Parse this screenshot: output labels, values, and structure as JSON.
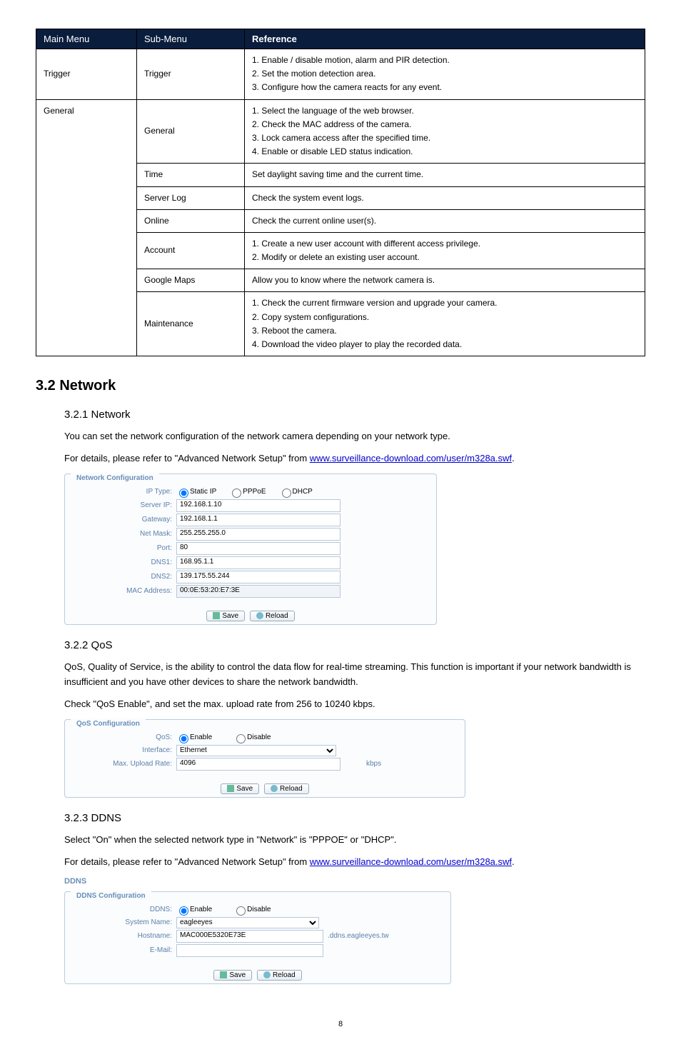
{
  "table": {
    "headers": [
      "Main Menu",
      "Sub-Menu",
      "Reference"
    ],
    "rows": [
      {
        "main": "Trigger",
        "sub": "Trigger",
        "ref": "1. Enable / disable motion, alarm and PIR detection.\n2. Set the motion detection area.\n3. Configure how the camera reacts for any event."
      },
      {
        "main": "General",
        "sub": "General",
        "ref": "1. Select the language of the web browser.\n2. Check the MAC address of the camera.\n3. Lock camera access after the specified time.\n4. Enable or disable LED status indication."
      },
      {
        "main": "",
        "sub": "Time",
        "ref": "Set daylight saving time and the current time."
      },
      {
        "main": "",
        "sub": "Server Log",
        "ref": "Check the system event logs."
      },
      {
        "main": "",
        "sub": "Online",
        "ref": "Check the current online user(s)."
      },
      {
        "main": "",
        "sub": "Account",
        "ref": "1. Create a new user account with different access privilege.\n2. Modify or delete an existing user account."
      },
      {
        "main": "",
        "sub": "Google Maps",
        "ref": "Allow you to know where the network camera is."
      },
      {
        "main": "",
        "sub": "Maintenance",
        "ref": "1. Check the current firmware version and upgrade your camera.\n2. Copy system configurations.\n3. Reboot the camera.\n4. Download the video player to play the recorded data."
      }
    ]
  },
  "sections": {
    "h2_1": "3.2 Network",
    "h3_1": "3.2.1 Network",
    "p1": "You can set the network configuration of the network camera depending on your network type.",
    "p2a": "For details, please refer to \"Advanced Network Setup\" from ",
    "link": "www.surveillance-download.com/user/m328a.swf",
    "p2b": ".",
    "h3_2": "3.2.2 QoS",
    "p3": "QoS, Quality of Service, is the ability to control the data flow for real-time streaming. This function is important if your network bandwidth is insufficient and you have other devices to share the network bandwidth.",
    "p4": "Check \"QoS Enable\", and set the max. upload rate from 256 to 10240 kbps.",
    "h3_3": "3.2.3 DDNS",
    "p5": "Select \"On\" when the selected network type in \"Network\" is \"PPPOE\" or \"DHCP\".",
    "p6a": "For details, please refer to \"Advanced Network Setup\" from "
  },
  "netcfg": {
    "legend": "Network Configuration",
    "iptype_lbl": "IP Type:",
    "opt_static": "Static IP",
    "opt_pppoe": "PPPoE",
    "opt_dhcp": "DHCP",
    "serverip_lbl": "Server IP:",
    "serverip_val": "192.168.1.10",
    "gateway_lbl": "Gateway:",
    "gateway_val": "192.168.1.1",
    "netmask_lbl": "Net Mask:",
    "netmask_val": "255.255.255.0",
    "port_lbl": "Port:",
    "port_val": "80",
    "dns1_lbl": "DNS1:",
    "dns1_val": "168.95.1.1",
    "dns2_lbl": "DNS2:",
    "dns2_val": "139.175.55.244",
    "mac_lbl": "MAC Address:",
    "mac_val": "00:0E:53:20:E7:3E",
    "save": "Save",
    "reload": "Reload"
  },
  "qos": {
    "legend": "QoS Configuration",
    "qos_lbl": "QoS:",
    "enable": "Enable",
    "disable": "Disable",
    "iface_lbl": "Interface:",
    "iface_val": "Ethernet",
    "max_lbl": "Max. Upload Rate:",
    "max_val": "4096",
    "unit": "kbps",
    "save": "Save",
    "reload": "Reload"
  },
  "ddns": {
    "title": "DDNS",
    "legend": "DDNS Configuration",
    "ddns_lbl": "DDNS:",
    "enable": "Enable",
    "disable": "Disable",
    "sys_lbl": "System Name:",
    "sys_val": "eagleeyes",
    "host_lbl": "Hostname:",
    "host_val": "MAC000E5320E73E",
    "suffix": ".ddns.eagleeyes.tw",
    "email_lbl": "E-Mail:",
    "email_val": "",
    "save": "Save",
    "reload": "Reload"
  },
  "page": "8"
}
